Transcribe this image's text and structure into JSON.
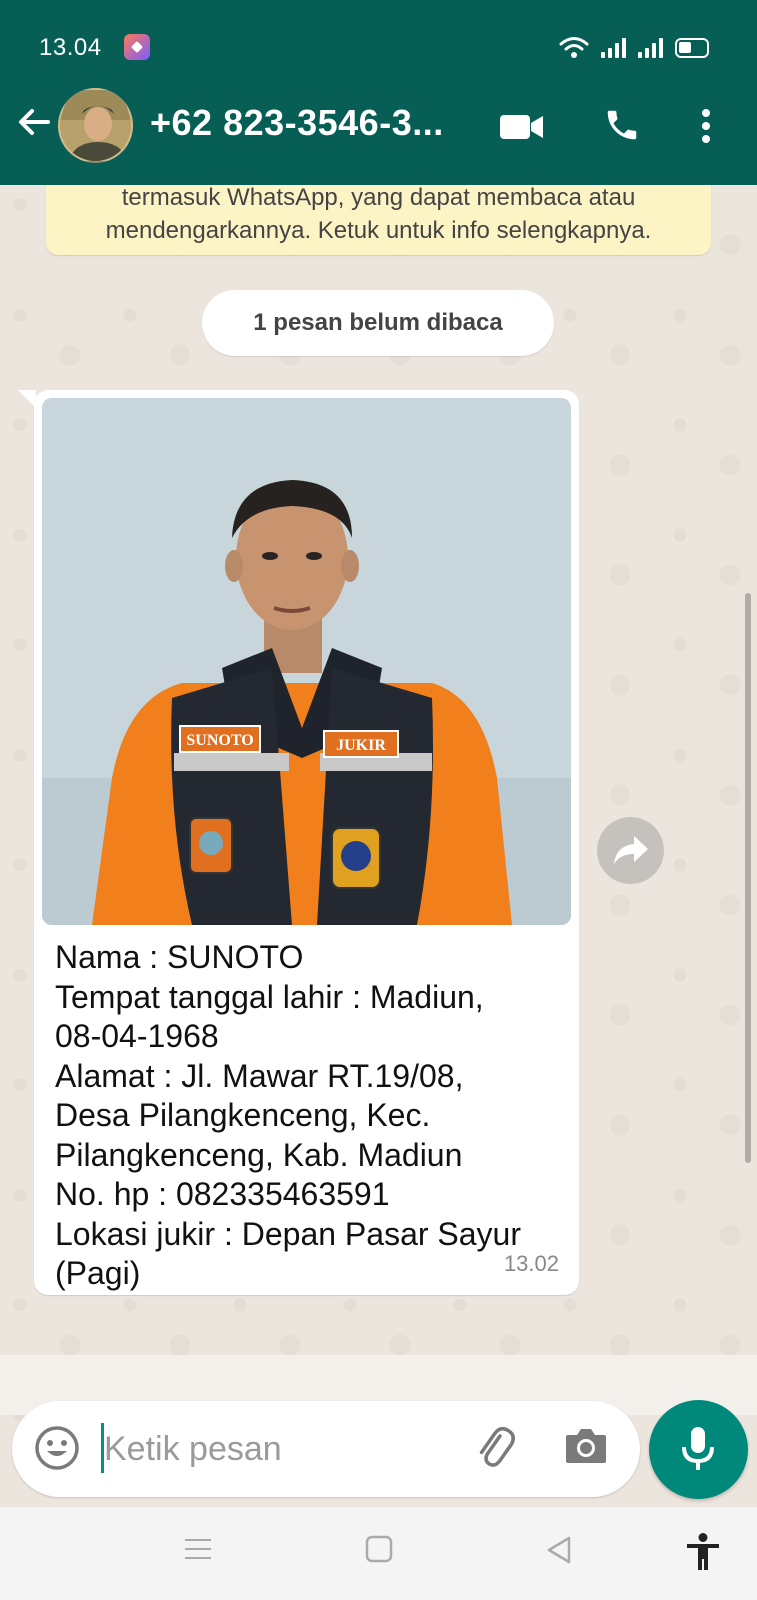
{
  "status_bar": {
    "time": "13.04",
    "icons": [
      "app-notification-icon",
      "wifi-icon",
      "signal-icon",
      "signal-icon",
      "battery-icon"
    ]
  },
  "header": {
    "title": "+62 823-3546-3...",
    "back_icon": "arrow-left-icon",
    "video_icon": "video-call-icon",
    "call_icon": "phone-icon",
    "menu_icon": "more-vertical-icon"
  },
  "chat": {
    "encryption_notice_line1": "termasuk WhatsApp, yang dapat membaca atau",
    "encryption_notice_line2": "mendengarkannya. Ketuk untuk info selengkapnya.",
    "unread_badge": "1 pesan belum dibaca",
    "message": {
      "caption_lines": [
        "Nama : SUNOTO",
        "Tempat tanggal lahir : Madiun,",
        "08-04-1968",
        "Alamat : Jl. Mawar RT.19/08,",
        "Desa Pilangkenceng, Kec.",
        "Pilangkenceng, Kab. Madiun",
        "No. hp : 082335463591",
        "Lokasi jukir : Depan Pasar Sayur",
        "(Pagi)"
      ],
      "time": "13.02",
      "photo_badges": {
        "name_patch": "SUNOTO",
        "role_patch": "JUKIR"
      }
    }
  },
  "input": {
    "placeholder": "Ketik pesan"
  },
  "colors": {
    "header": "#075e54",
    "accent": "#00897b",
    "chat_background": "#ece5dd",
    "notice_background": "#fdf4c5",
    "vest_orange": "#f07f1c"
  }
}
